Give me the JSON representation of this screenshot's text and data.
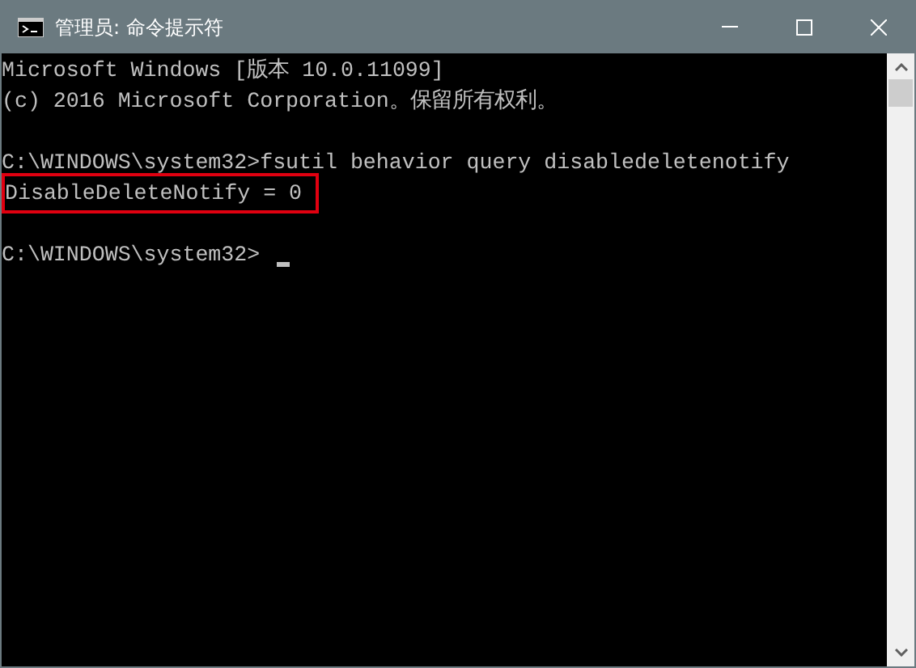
{
  "window": {
    "title": "管理员: 命令提示符"
  },
  "console": {
    "lines": [
      {
        "text": "Microsoft Windows [版本 10.0.11099]",
        "highlighted": false,
        "cursor": false
      },
      {
        "text": "(c) 2016 Microsoft Corporation。保留所有权利。",
        "highlighted": false,
        "cursor": false
      },
      {
        "highlighted": false,
        "cursor": false
      },
      {
        "text": "C:\\WINDOWS\\system32>fsutil behavior query disabledeletenotify",
        "highlighted": false,
        "cursor": false
      },
      {
        "text": "DisableDeleteNotify = 0",
        "highlighted": true,
        "cursor": false
      },
      {
        "highlighted": false,
        "cursor": false
      },
      {
        "text": "C:\\WINDOWS\\system32>",
        "highlighted": false,
        "cursor": true
      }
    ]
  }
}
